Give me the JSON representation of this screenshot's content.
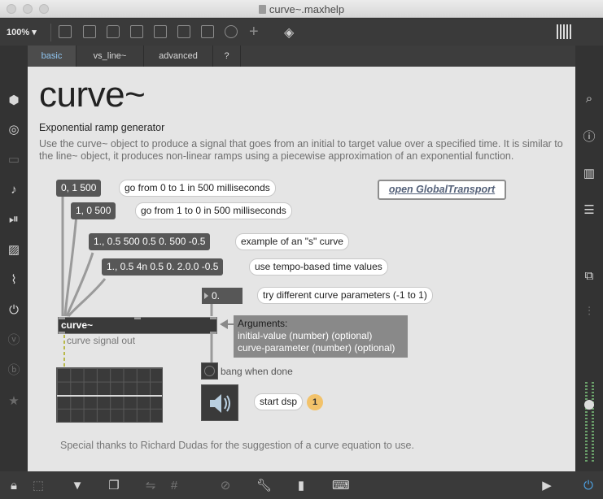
{
  "window": {
    "title": "curve~.maxhelp"
  },
  "toolbar": {
    "zoom": "100%"
  },
  "tabs": [
    {
      "label": "basic",
      "active": true
    },
    {
      "label": "vs_line~",
      "active": false
    },
    {
      "label": "advanced",
      "active": false
    },
    {
      "label": "?",
      "active": false
    }
  ],
  "header": {
    "title": "curve~",
    "subtitle": "Exponential ramp generator",
    "description": "Use the curve~ object to produce a signal that goes from an initial to target value over a specified time. It is similar to the line~ object, it produces non-linear ramps using a piecewise approximation of an exponential function."
  },
  "patch": {
    "messages": [
      {
        "text": "0, 1 500",
        "comment": "go from 0 to 1 in 500 milliseconds"
      },
      {
        "text": "1, 0 500",
        "comment": "go from 1 to 0 in 500 milliseconds"
      },
      {
        "text": "1., 0.5 500 0.5 0. 500 -0.5",
        "comment": "example of an \"s\" curve"
      },
      {
        "text": "1., 0.5 4n 0.5 0. 2.0.0 -0.5",
        "comment": "use tempo-based time values"
      }
    ],
    "number_box": {
      "value": "0.",
      "comment": "try different curve parameters (-1 to 1)"
    },
    "global_transport_link": "open GlobalTransport",
    "curve_object": "curve~",
    "signal_out_label": "curve signal out",
    "arguments": {
      "title": "Arguments:",
      "line1": "initial-value (number) (optional)",
      "line2": "curve-parameter (number) (optional)"
    },
    "bang_label": "bang when done",
    "dsp_comment": "start dsp",
    "dsp_badge": "1",
    "thanks": "Special thanks to Richard Dudas for the suggestion of a curve equation to use."
  },
  "colors": {
    "canvas": "#e5e5e5",
    "object_bg": "#575757",
    "active_tab_text": "#8fc4ef",
    "badge": "#f2c26a"
  }
}
